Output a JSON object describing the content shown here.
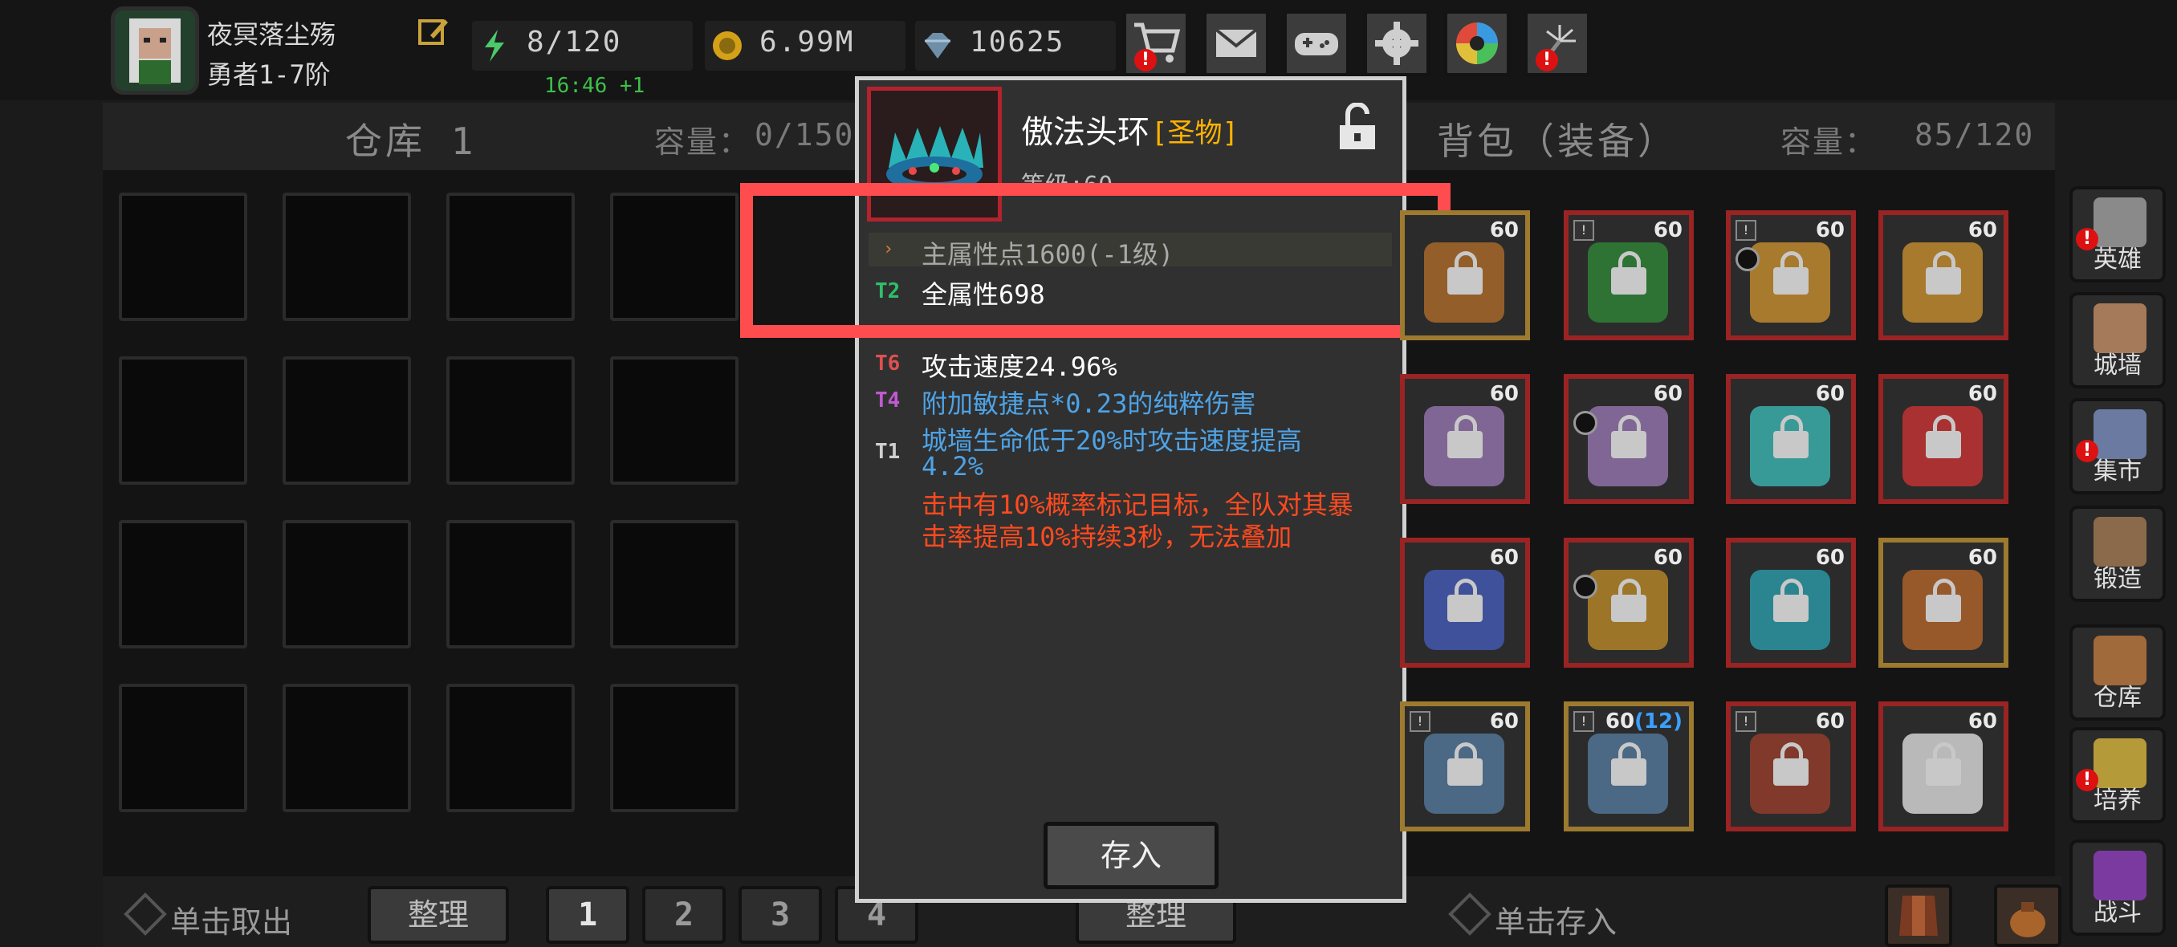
{
  "player": {
    "name": "夜冥落尘殇",
    "rank": "勇者1-7阶"
  },
  "resources": {
    "energy": "8/120",
    "energy_timer": "16:46 +1",
    "gold": "6.99M",
    "gems": "10625"
  },
  "top_buttons": [
    "shop-cart",
    "mail",
    "gamepad",
    "settings",
    "color-wheel",
    "fireworks"
  ],
  "warehouse": {
    "title": "仓库 1",
    "capacity_label": "容量：",
    "capacity": "0/150"
  },
  "backpack": {
    "title": "背包（装备）",
    "capacity_label": "容量：",
    "capacity": "85/120"
  },
  "backpack_items": [
    {
      "level": "60",
      "frame": "gold",
      "art": "#a0642a"
    },
    {
      "level": "60",
      "frame": "red",
      "art": "#2f7a35",
      "badge": true
    },
    {
      "level": "60",
      "frame": "red",
      "art": "#b5832e",
      "badge": true,
      "ring": true
    },
    {
      "level": "60",
      "frame": "red",
      "art": "#b5832e"
    },
    {
      "level": "60",
      "frame": "red",
      "art": "#8a6da0"
    },
    {
      "level": "60",
      "frame": "red",
      "art": "#8a6da0",
      "ring": true
    },
    {
      "level": "60",
      "frame": "red",
      "art": "#3aa6a3"
    },
    {
      "level": "60",
      "frame": "red",
      "art": "#b83232"
    },
    {
      "level": "60",
      "frame": "red",
      "art": "#4055a6"
    },
    {
      "level": "60",
      "frame": "red",
      "art": "#a87d28",
      "ring": true
    },
    {
      "level": "60",
      "frame": "red",
      "art": "#2a8f9b"
    },
    {
      "level": "60",
      "frame": "gold",
      "art": "#a35d2a"
    },
    {
      "level": "60",
      "frame": "gold",
      "art": "#4f6f8f",
      "badge": true
    },
    {
      "level": "60",
      "sub": "(12)",
      "frame": "gold",
      "art": "#4f6f8f",
      "badge": true
    },
    {
      "level": "60",
      "frame": "red",
      "art": "#8a3b2a",
      "badge": true
    },
    {
      "level": "60",
      "frame": "red",
      "art": "#c9c9c9"
    }
  ],
  "bottom": {
    "withdraw_hint": "单击取出",
    "sort_label": "整理",
    "pages": [
      "1",
      "2",
      "3",
      "4"
    ],
    "sort_label_2": "整理",
    "deposit_hint": "单击存入"
  },
  "nav": [
    {
      "label": "英雄",
      "alert": true,
      "color": "#8a8a8a"
    },
    {
      "label": "城墙",
      "alert": false,
      "color": "#a57a5a"
    },
    {
      "label": "集市",
      "alert": true,
      "color": "#6b7aa0"
    },
    {
      "label": "锻造",
      "alert": false,
      "color": "#8a6a4a"
    },
    {
      "label": "仓库",
      "alert": false,
      "color": "#a06a3a"
    },
    {
      "label": "培养",
      "alert": true,
      "color": "#b59a3a"
    },
    {
      "label": "战斗",
      "alert": false,
      "color": "#7a3aa0"
    }
  ],
  "tooltip": {
    "name": "傲法头环",
    "grade": "[圣物]",
    "level": "等级:60",
    "main_stat": "主属性点1600(-1级)",
    "affixes": [
      {
        "tier": "T2",
        "tier_color": "#2fc06a",
        "text": "全属性698",
        "color": "#ffffff"
      },
      {
        "tier": "T6",
        "tier_color": "#e05050",
        "text": "攻击速度24.96%",
        "color": "#ffffff"
      },
      {
        "tier": "T4",
        "tier_color": "#c05ad0",
        "text": "附加敏捷点*0.23的纯粹伤害",
        "color": "#4ea3e6"
      },
      {
        "tier": "T1",
        "tier_color": "#d0d0d0",
        "text": "城墙生命低于20%时攻击速度提高",
        "text2": "4.2%",
        "color": "#4ea3e6"
      }
    ],
    "special": [
      "击中有10%概率标记目标，全队对其暴",
      "击率提高10%持续3秒，无法叠加"
    ],
    "save_button": "存入"
  },
  "colors": {
    "highlight": "#ff4d4f",
    "legendary_frame": "#b3232e",
    "grade_gold": "#ffb300",
    "special_red": "#ff4a1f"
  }
}
